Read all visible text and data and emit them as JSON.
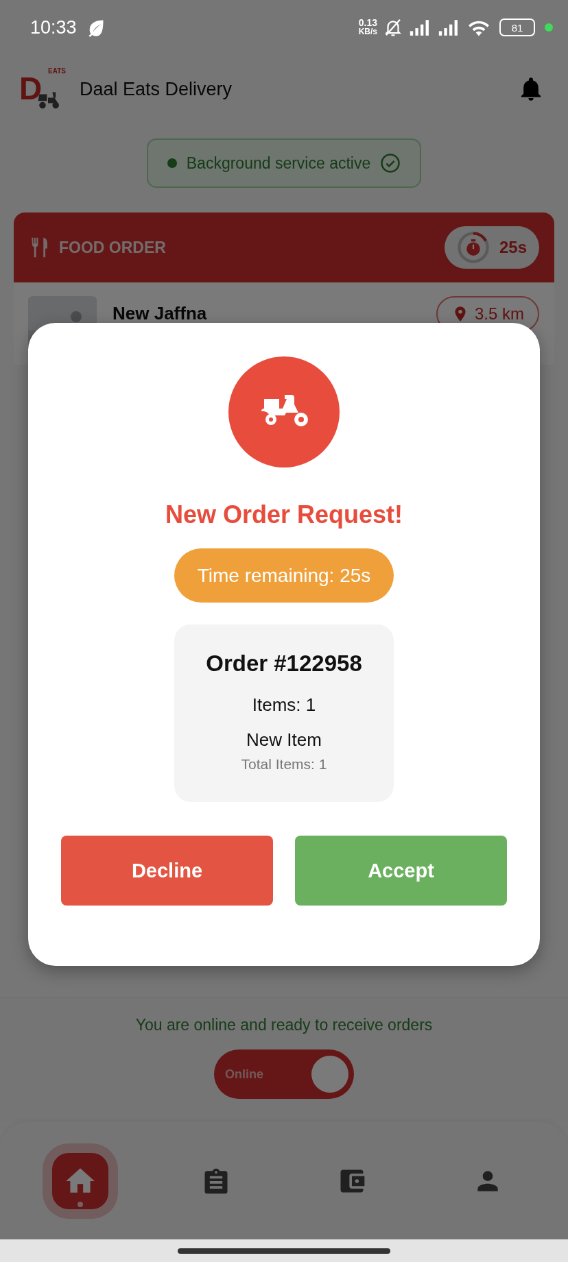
{
  "status_bar": {
    "time": "10:33",
    "net_speed": "0.13",
    "net_unit": "KB/s",
    "battery": "81"
  },
  "app_bar": {
    "logo_mark": "D",
    "logo_tag": "EATS",
    "title": "Daal Eats Delivery"
  },
  "service_status": {
    "label": "Background service active",
    "active": true
  },
  "order_card": {
    "type_label": "FOOD ORDER",
    "timer": "25s",
    "timer_ring": {
      "level": 0.17
    },
    "restaurant": "New Jaffna",
    "distance": "3.5 km"
  },
  "dialog": {
    "title": "New Order Request!",
    "time_remaining": "Time remaining: 25s",
    "order_number": "Order #122958",
    "items_count": "Items: 1",
    "items": [
      "New Item"
    ],
    "total_items": "Total Items: 1",
    "buttons": [
      {
        "label": "Decline",
        "kind": "decline"
      },
      {
        "label": "Accept",
        "kind": "accept"
      }
    ]
  },
  "online_panel": {
    "message": "You are online and ready to receive orders",
    "toggle": {
      "label": "Online",
      "on": true
    }
  },
  "bottom_nav": [
    {
      "kind": "home",
      "selected": true
    },
    {
      "kind": "orders",
      "selected": false
    },
    {
      "kind": "wallet",
      "selected": false
    },
    {
      "kind": "profile",
      "selected": false
    }
  ]
}
